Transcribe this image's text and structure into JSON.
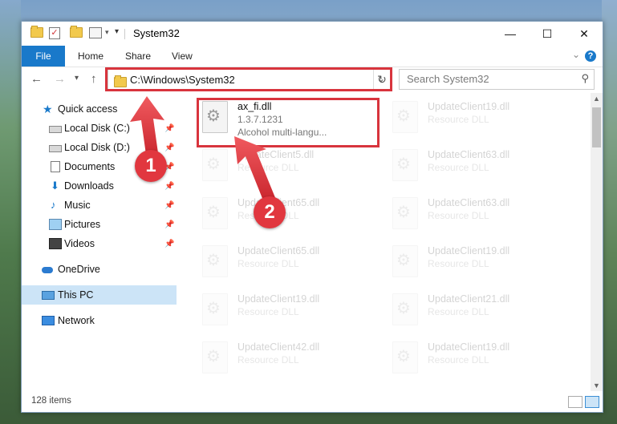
{
  "window": {
    "title": "System32",
    "controls": {
      "minimize": "—",
      "maximize": "☐",
      "close": "✕"
    }
  },
  "ribbon": {
    "tabs": [
      {
        "label": "File"
      },
      {
        "label": "Home"
      },
      {
        "label": "Share"
      },
      {
        "label": "View"
      }
    ],
    "help": "?"
  },
  "navbar": {
    "address": "C:\\Windows\\System32",
    "search_placeholder": "Search System32"
  },
  "sidebar": {
    "quick_access": "Quick access",
    "items": [
      {
        "label": "Local Disk (C:)"
      },
      {
        "label": "Local Disk (D:)"
      },
      {
        "label": "Documents"
      },
      {
        "label": "Downloads"
      },
      {
        "label": "Music"
      },
      {
        "label": "Pictures"
      },
      {
        "label": "Videos"
      }
    ],
    "onedrive": "OneDrive",
    "this_pc": "This PC",
    "network": "Network"
  },
  "files": {
    "highlighted": {
      "name": "ax_fi.dll",
      "version": "1.3.7.1231",
      "description": "Alcohol multi-langu..."
    },
    "others": [
      {
        "name": "UpdateClient19.dll",
        "type": "Resource DLL"
      },
      {
        "name": "UpdateClient5.dll",
        "type": "Resource DLL"
      },
      {
        "name": "UpdateClient63.dll",
        "type": "Resource DLL"
      },
      {
        "name": "UpdateClient65.dll",
        "type": "Resource DLL"
      },
      {
        "name": "UpdateClient63.dll",
        "type": "Resource DLL"
      },
      {
        "name": "UpdateClient65.dll",
        "type": "Resource DLL"
      },
      {
        "name": "UpdateClient19.dll",
        "type": "Resource DLL"
      },
      {
        "name": "UpdateClient19.dll",
        "type": "Resource DLL"
      },
      {
        "name": "UpdateClient21.dll",
        "type": "Resource DLL"
      },
      {
        "name": "UpdateClient42.dll",
        "type": "Resource DLL"
      },
      {
        "name": "UpdateClient19.dll",
        "type": "Resource DLL"
      }
    ]
  },
  "status": {
    "items": "128 items"
  },
  "callouts": {
    "one": "1",
    "two": "2"
  },
  "colors": {
    "accent": "#1979ca",
    "highlight": "#d8343d",
    "callout": "#e1373f"
  }
}
